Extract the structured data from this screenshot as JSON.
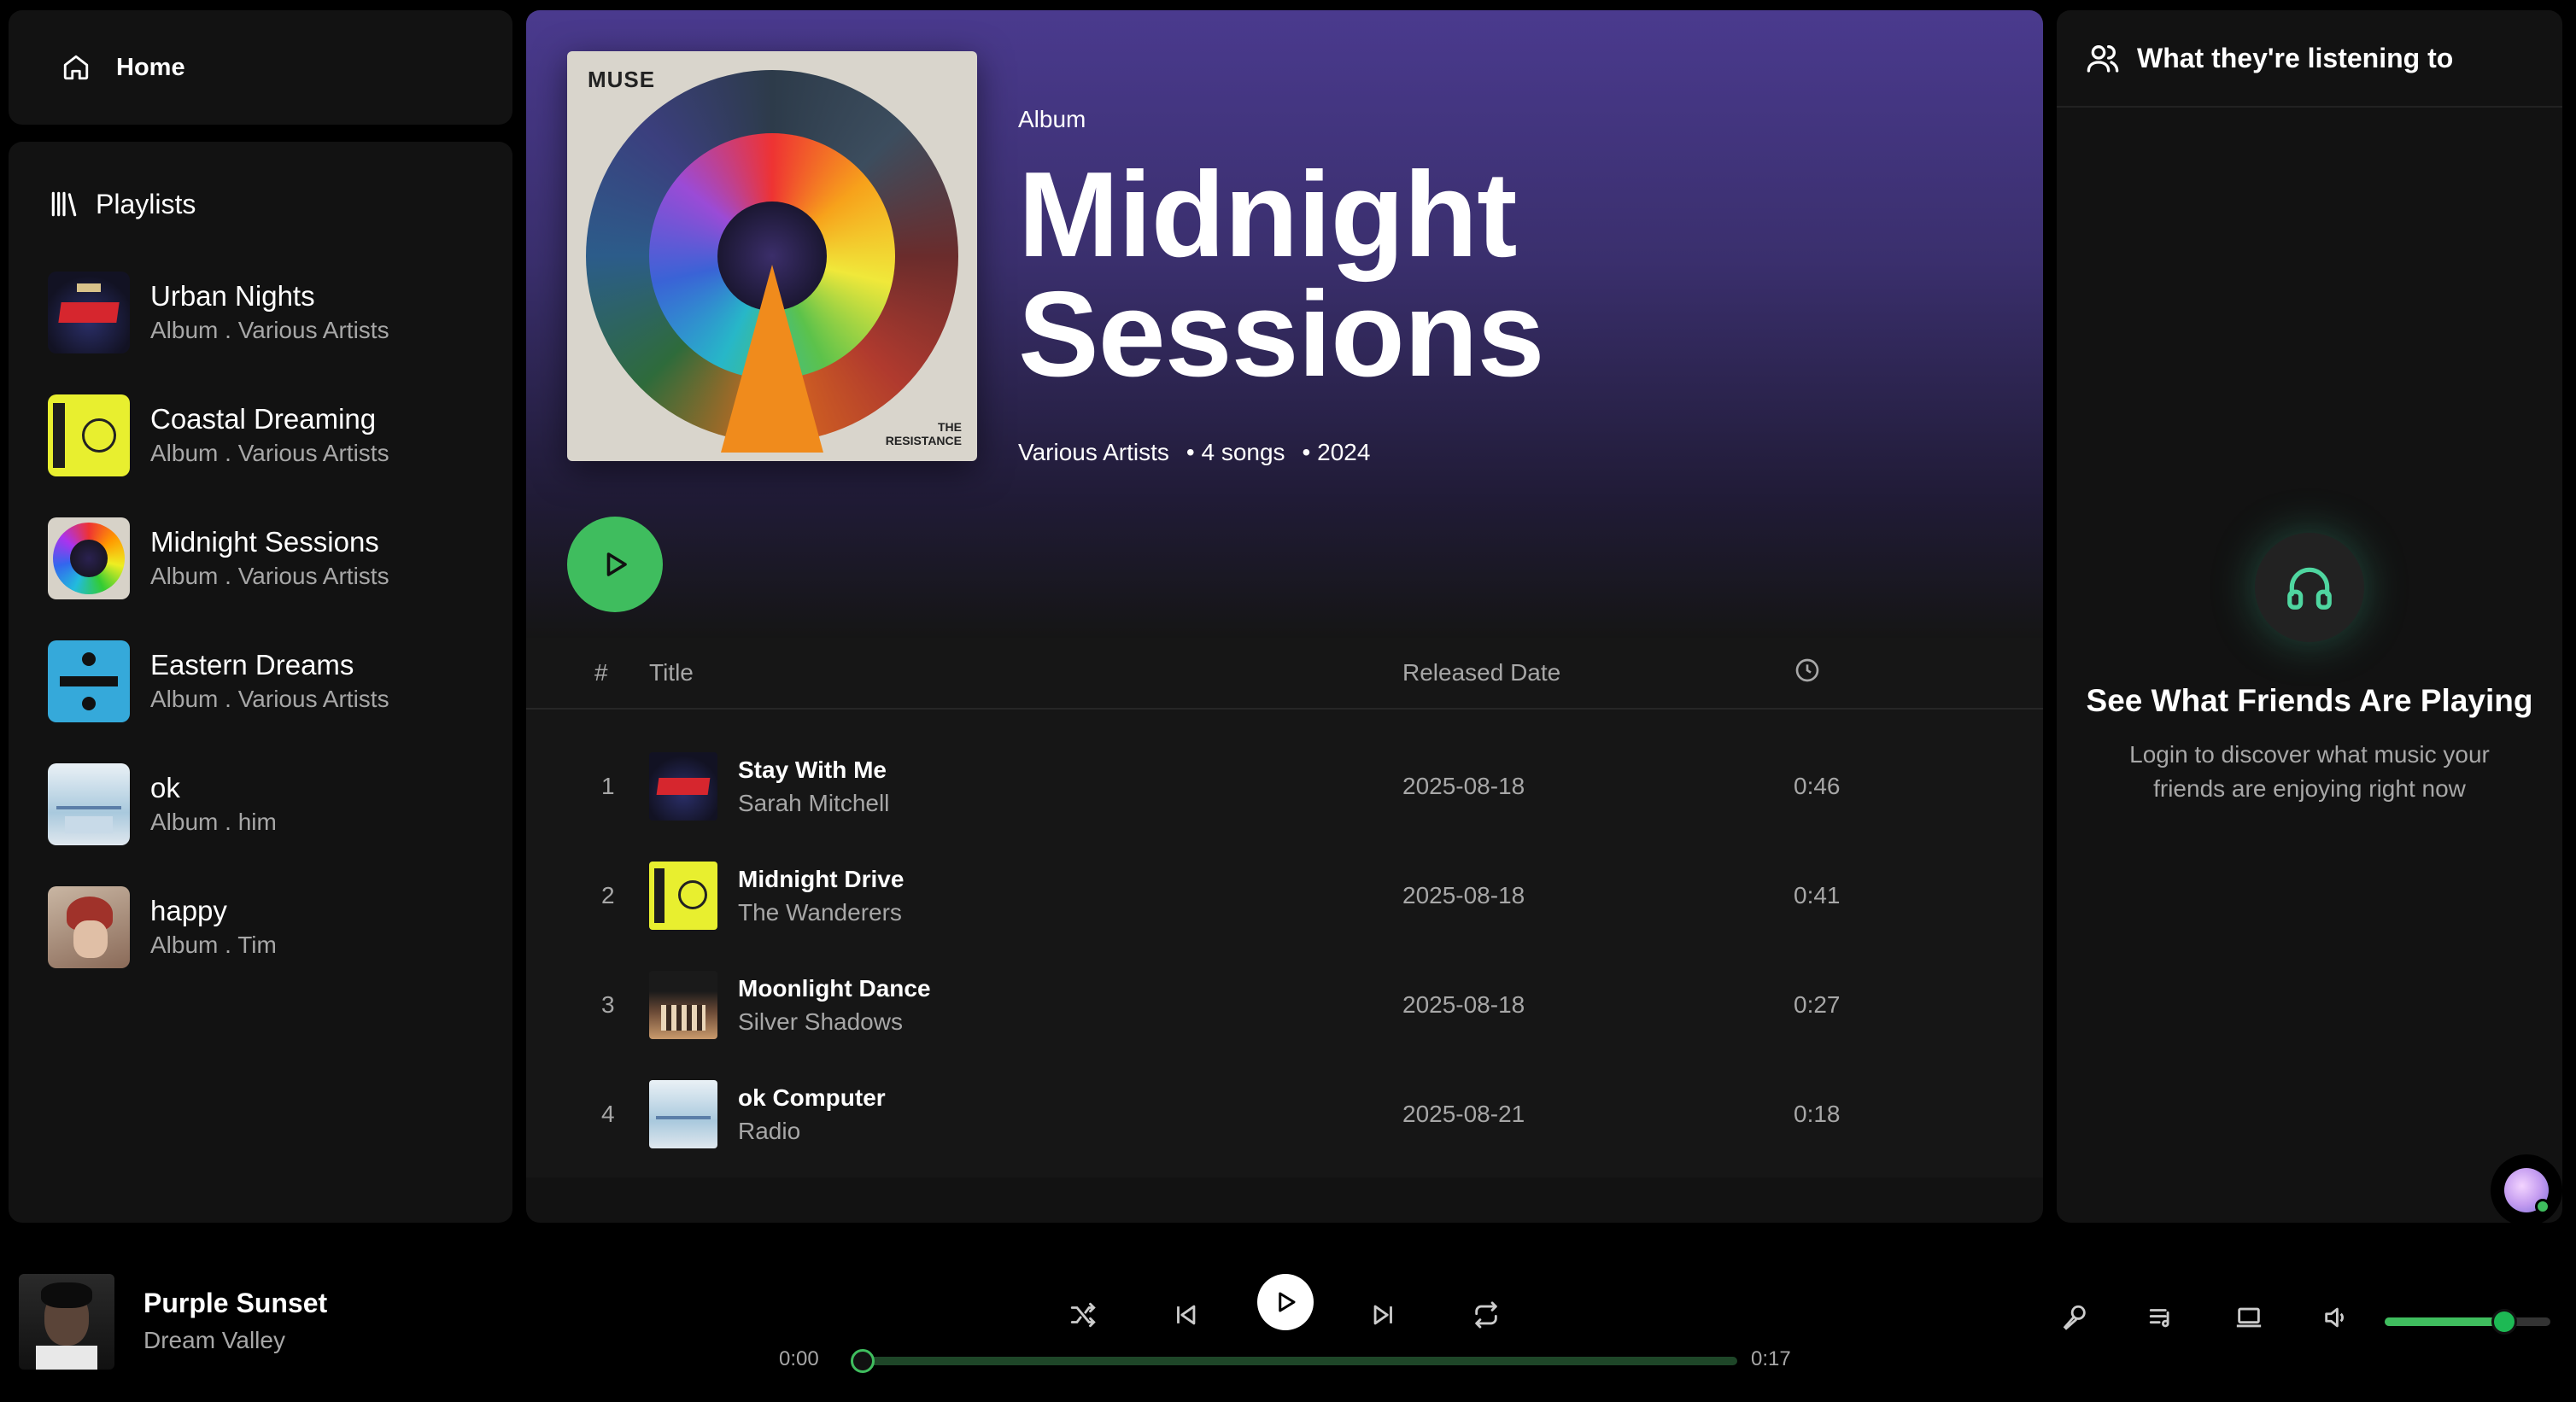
{
  "nav": {
    "home_label": "Home"
  },
  "playlists": {
    "header": "Playlists",
    "items": [
      {
        "title": "Urban Nights",
        "subtitle": "Album . Various Artists",
        "art": "enemy-cover"
      },
      {
        "title": "Coastal Dreaming",
        "subtitle": "Album . Various Artists",
        "art": "yellow-cover"
      },
      {
        "title": "Midnight Sessions",
        "subtitle": "Album . Various Artists",
        "art": "resistance-cover"
      },
      {
        "title": "Eastern Dreams",
        "subtitle": "Album . Various Artists",
        "art": "divide-cover"
      },
      {
        "title": "ok",
        "subtitle": "Album . him",
        "art": "okc-cover"
      },
      {
        "title": "happy",
        "subtitle": "Album . Tim",
        "art": "portrait-cover"
      }
    ]
  },
  "album": {
    "type_label": "Album",
    "title_line1": "Midnight",
    "title_line2": "Sessions",
    "artist": "Various Artists",
    "songs": "4 songs",
    "year": "2024",
    "cover_brand": "MUSE",
    "cover_caption": "THE\nRESISTANCE"
  },
  "tracklist": {
    "headers": {
      "num": "#",
      "title": "Title",
      "date": "Released Date"
    },
    "rows": [
      {
        "num": "1",
        "title": "Stay With Me",
        "artist": "Sarah Mitchell",
        "date": "2025-08-18",
        "duration": "0:46"
      },
      {
        "num": "2",
        "title": "Midnight Drive",
        "artist": "The Wanderers",
        "date": "2025-08-18",
        "duration": "0:41"
      },
      {
        "num": "3",
        "title": "Moonlight Dance",
        "artist": "Silver Shadows",
        "date": "2025-08-18",
        "duration": "0:27"
      },
      {
        "num": "4",
        "title": "ok Computer",
        "artist": "Radio",
        "date": "2025-08-21",
        "duration": "0:18"
      }
    ]
  },
  "friends": {
    "header": "What they're listening to",
    "title": "See What Friends Are Playing",
    "description": "Login to discover what music your friends are enjoying right now"
  },
  "player": {
    "title": "Purple Sunset",
    "artist": "Dream Valley",
    "current_time": "0:00",
    "total_time": "0:17",
    "progress": 0,
    "volume": 0.72
  },
  "colors": {
    "accent": "#3fbd5e",
    "hero_top": "#4a3a8e",
    "panel": "#121212"
  }
}
